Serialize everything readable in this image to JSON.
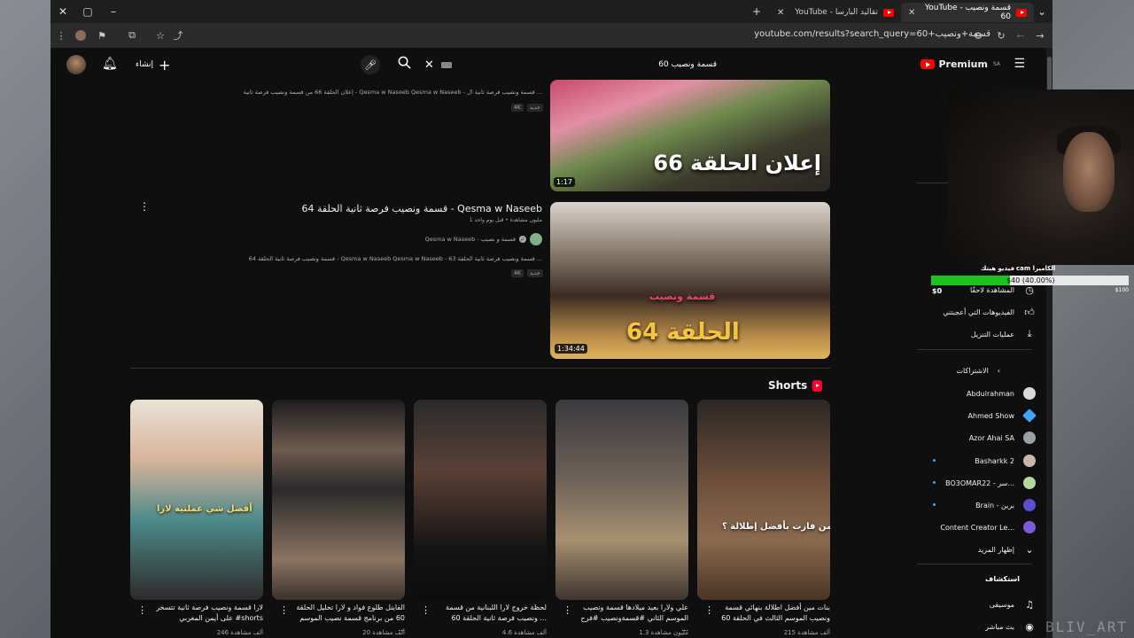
{
  "browser": {
    "tabs": [
      {
        "title": "YouTube - قسمة ونصيب 60",
        "active": true
      },
      {
        "title": "YouTube - تقاليد البارسا",
        "active": false
      }
    ],
    "url": "youtube.com/results?search_query=60+قسمة+ونصيب"
  },
  "masthead": {
    "create_label": "إنشاء",
    "search_query": "قسمة ونصيب 60",
    "premium_label": "Premium",
    "premium_region": "SA"
  },
  "results": [
    {
      "title": "",
      "description": "إعلان الحلقة 66 من قسمة ونصيب فرصة ثانية - Qesma w Naseeb Qesma w Naseeb - قسمة ونصيب فرصة ثانية ال ...",
      "badge": "4K",
      "badge_new": "جديد",
      "thumb_caption": "إعلان الحلقة 66",
      "duration": "1:17"
    },
    {
      "title": "قسمة ونصيب فرصة ثانية الحلقة 64 - Qesma w Naseeb",
      "meta": "1 مليون مشاهدة • قبل يوم واحد",
      "channel": "Qesma w Naseeb - قسمة و نصيب",
      "description": "قسمة ونصيب فرصة ثانية الحلقة 64 - Qesma w Naseeb Qesma w Naseeb - قسمة ونصيب فرصة ثانية الحلقة 63 ...",
      "badge": "4K",
      "badge_new": "جديد",
      "thumb_caption": "الحلقة 64",
      "thumb_logo": "قسمة ونصيب",
      "duration": "1:34:44"
    }
  ],
  "shorts": {
    "heading": "Shorts",
    "items": [
      {
        "title": "بنات مين أفضل اطلالة بنهائي قسمة ونصيب الموسم الثالث في الحلقة 60",
        "views": "215 ألف مشاهدة",
        "overlay": "من فازت بأفضل إطلالة ؟"
      },
      {
        "title": "علي ولارا بعيد ميلادها قسمة ونصيب الموسم الثاني #قسمةونصيب #فرح ...",
        "views": "1.3 مليون مشاهدة",
        "overlay": ""
      },
      {
        "title": "لحظة خروج لارا اللبنانية من قسمة ونصيب فرصة ثانية الحلقة 60 ...",
        "views": "4.6 ألف مشاهدة",
        "overlay": ""
      },
      {
        "title": "الفاينل طلوع فواد و لارا تحليل الحلقة 60 من برنامج قسمة نصيب الموسم ...",
        "views": "20 ألف مشاهدة",
        "overlay": ""
      },
      {
        "title": "لارا قسمة ونصيب فرصة ثانية تتسخر على أيمن المغربي #shorts",
        "views": "246 ألف مشاهدة",
        "overlay": "أفضل شي عملتيه لارا"
      }
    ]
  },
  "sidebar": {
    "items": [
      {
        "label": "المشاهدة لاحقًا",
        "icon": "clock-icon"
      },
      {
        "label": "الفيديوهات التي أعجبتني",
        "icon": "thumbs-up-icon"
      },
      {
        "label": "عمليات التنزيل",
        "icon": "download-icon"
      }
    ],
    "subscriptions_heading": "الاشتراكات",
    "subscriptions": [
      {
        "name": "Abdulrahman",
        "color": "#d9d9d9",
        "dot": false
      },
      {
        "name": "Ahmed Show",
        "color": "#3ea6ff",
        "dot": false
      },
      {
        "name": "Azor Ahai SA",
        "color": "#9aa0a6",
        "dot": false
      },
      {
        "name": "Basharkk 2",
        "color": "#c9b8a8",
        "dot": true
      },
      {
        "name": "BO3OMAR22 - سر...",
        "color": "#b5d99c",
        "dot": true
      },
      {
        "name": "Brain - برين",
        "color": "#5a4fd1",
        "dot": true
      },
      {
        "name": "Content Creator Le...",
        "color": "#7b5cd6",
        "dot": false
      }
    ],
    "show_more": "إظهار المزيد",
    "explore_heading": "استكشاف",
    "explore": [
      {
        "label": "موسيقى",
        "icon": "music-icon"
      },
      {
        "label": "بث مباشر",
        "icon": "live-icon"
      }
    ]
  },
  "overlay": {
    "donation_left_label": "فيديو هيتك",
    "donation_right_label": "cam الكاميرا",
    "donation_text": "$40 (40.00%)",
    "donation_progress": 0.4,
    "donation_min": "$0",
    "donation_max": "$100",
    "watermark": "BLIV_ART"
  },
  "colors": {
    "background": "#0f0f0f",
    "youtube_red": "#ff0000",
    "progress_green": "#1ec41e"
  }
}
